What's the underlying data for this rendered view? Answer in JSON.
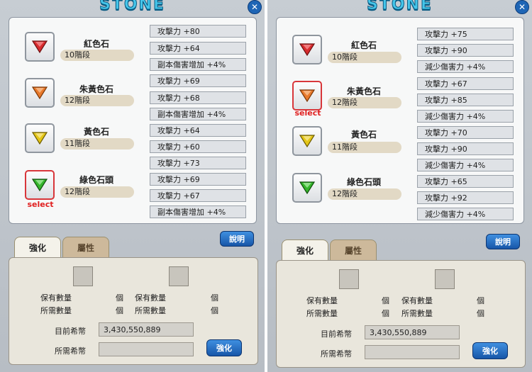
{
  "colors": {
    "red_gem": "#d72b2e",
    "orange_gem": "#e8792c",
    "yellow_gem": "#e4c617",
    "green_gem": "#35b52b",
    "select": "#e02020",
    "button": "#1e65b5"
  },
  "panels": [
    {
      "title": "STONE",
      "close_icon": "close-icon",
      "gems": [
        {
          "name": "紅色石",
          "level": "10階段",
          "color": "red",
          "selected": false
        },
        {
          "name": "朱黃色石",
          "level": "12階段",
          "color": "orange",
          "selected": false
        },
        {
          "name": "黃色石",
          "level": "11階段",
          "color": "yellow",
          "selected": false
        },
        {
          "name": "綠色石頭",
          "level": "12階段",
          "color": "green",
          "selected": true
        }
      ],
      "select_label": "select",
      "stats": [
        "攻擊力 +80",
        "攻擊力 +64",
        "副本傷害增加 +4%",
        "攻擊力 +69",
        "攻擊力 +68",
        "副本傷害增加 +4%",
        "攻擊力 +64",
        "攻擊力 +60",
        "攻擊力 +73",
        "攻擊力 +69",
        "攻擊力 +67",
        "副本傷害增加 +4%"
      ],
      "explain_button": "說明",
      "tabs": [
        "強化",
        "屬性"
      ],
      "owned_label": "保有數量",
      "required_label": "所需數量",
      "unit": "個",
      "current_coins_label": "目前希幣",
      "current_coins_value": "3,430,550,889",
      "required_coins_label": "所需希幣",
      "required_coins_value": "",
      "upgrade_button": "強化"
    },
    {
      "title": "STONE",
      "close_icon": "close-icon",
      "gems": [
        {
          "name": "紅色石",
          "level": "10階段",
          "color": "red",
          "selected": false
        },
        {
          "name": "朱黃色石",
          "level": "12階段",
          "color": "orange",
          "selected": true
        },
        {
          "name": "黃色石",
          "level": "11階段",
          "color": "yellow",
          "selected": false
        },
        {
          "name": "綠色石頭",
          "level": "12階段",
          "color": "green",
          "selected": false
        }
      ],
      "select_label": "select",
      "stats": [
        "攻擊力 +75",
        "攻擊力 +90",
        "減少傷害力 +4%",
        "攻擊力 +67",
        "攻擊力 +85",
        "減少傷害力 +4%",
        "攻擊力 +70",
        "攻擊力 +90",
        "減少傷害力 +4%",
        "攻擊力 +65",
        "攻擊力 +92",
        "減少傷害力 +4%"
      ],
      "explain_button": "說明",
      "tabs": [
        "強化",
        "屬性"
      ],
      "owned_label": "保有數量",
      "required_label": "所需數量",
      "unit": "個",
      "current_coins_label": "目前希幣",
      "current_coins_value": "3,430,550,889",
      "required_coins_label": "所需希幣",
      "required_coins_value": "",
      "upgrade_button": "強化"
    }
  ]
}
